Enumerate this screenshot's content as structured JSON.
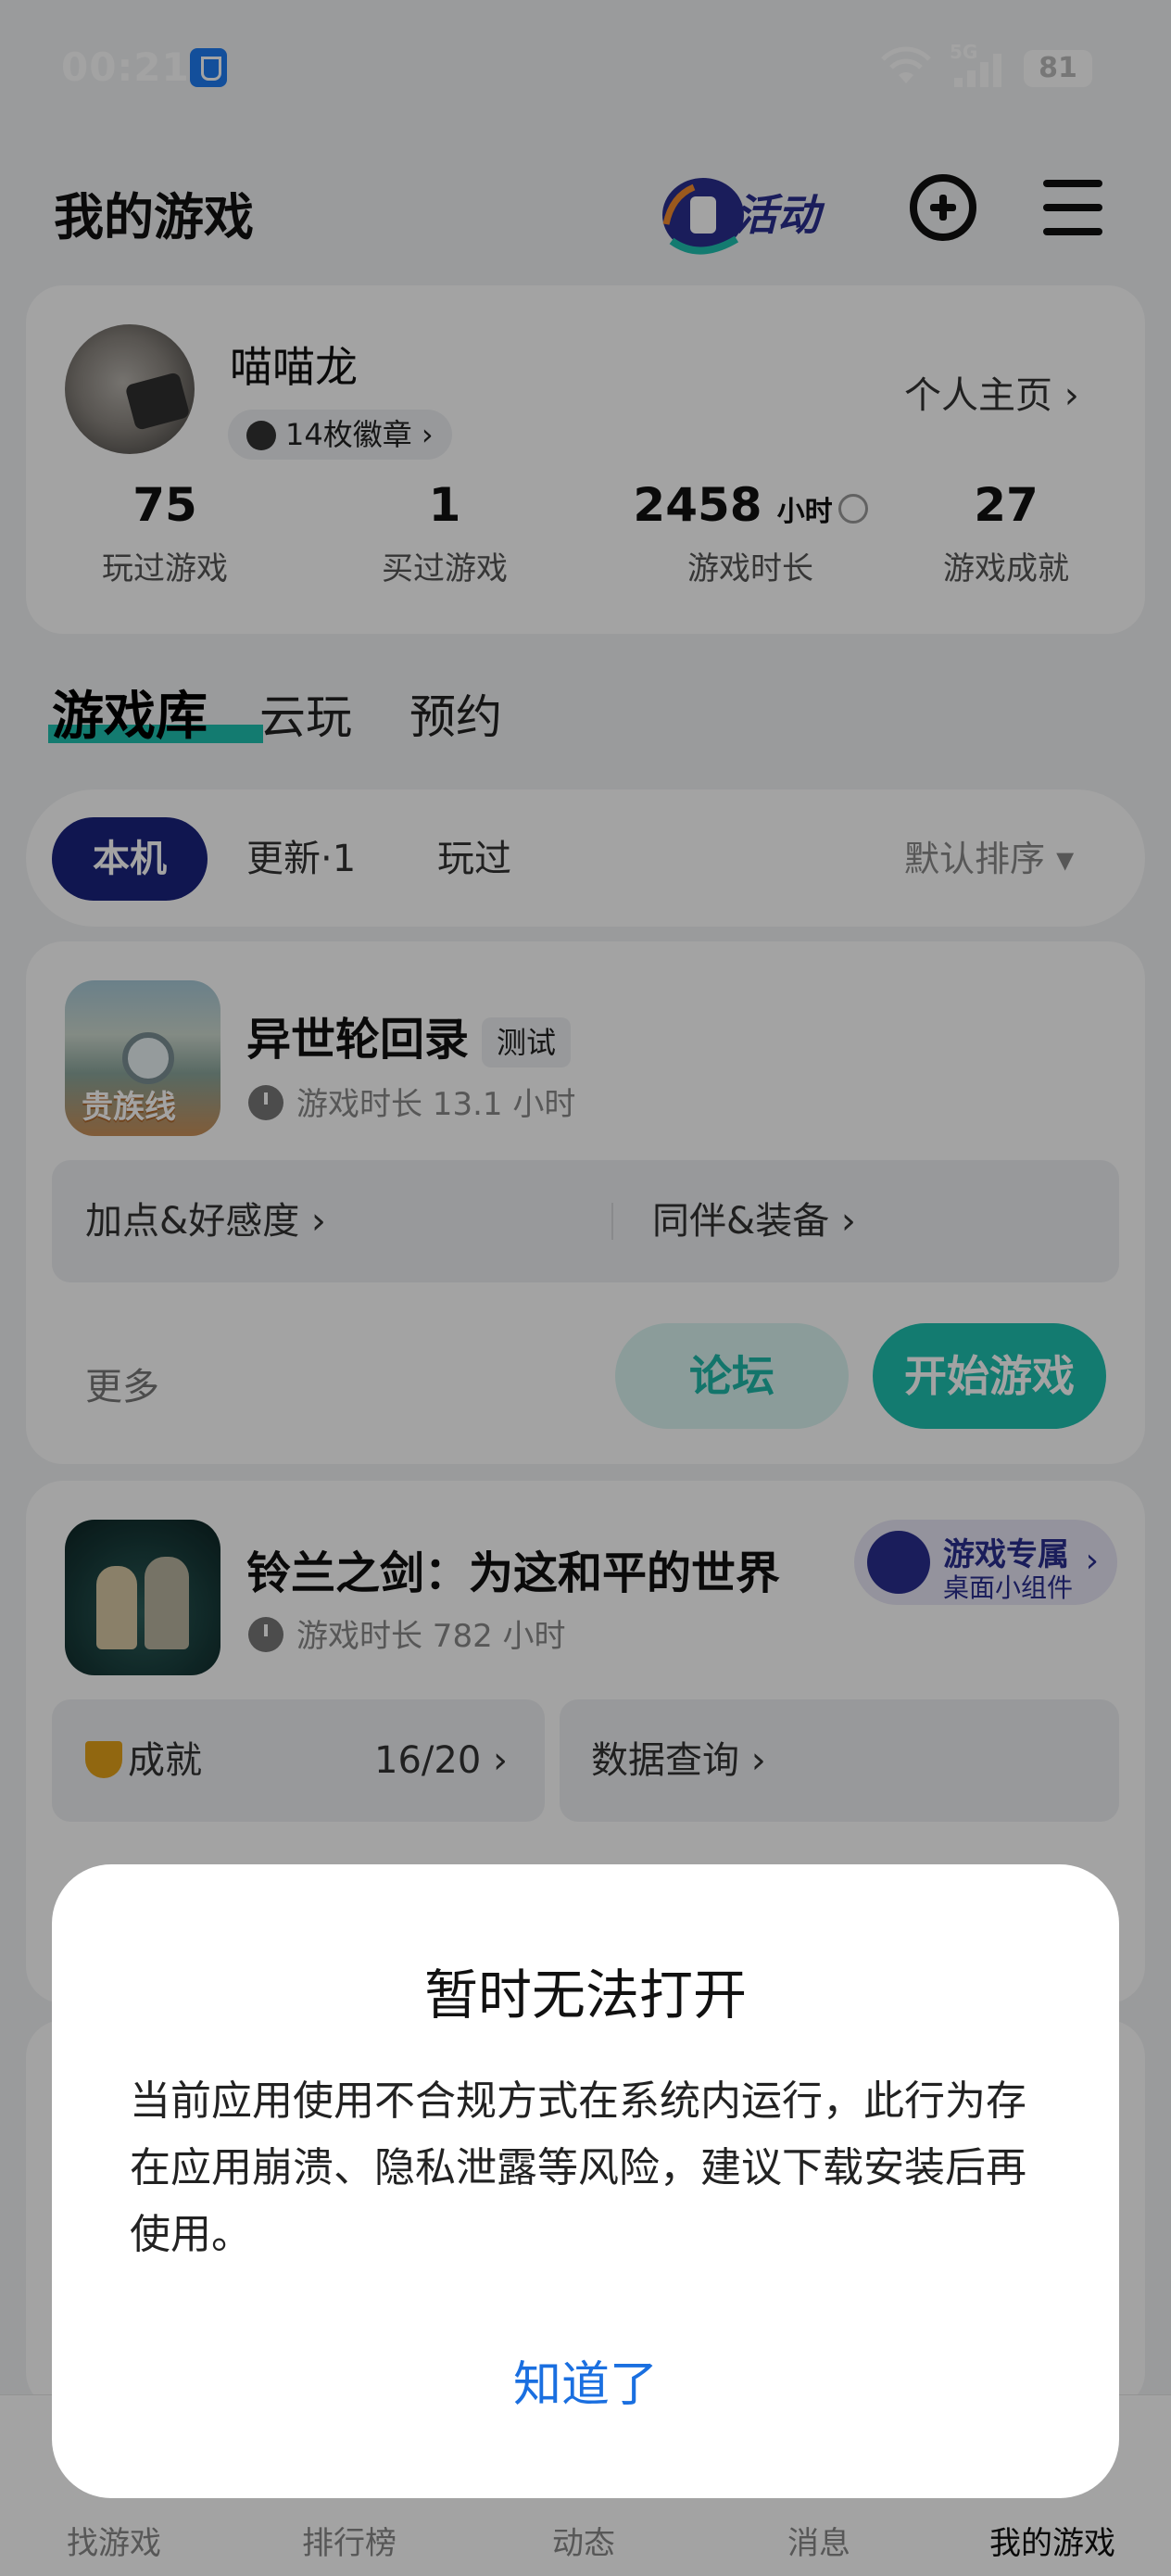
{
  "status_bar": {
    "time": "00:21",
    "network": "5G",
    "battery": "81"
  },
  "header": {
    "title": "我的游戏",
    "activity_label": "活动"
  },
  "profile": {
    "username": "喵喵龙",
    "badges": "14枚徽章 ›",
    "home_link": "个人主页 ›",
    "stats": [
      {
        "value": "75",
        "unit": "",
        "label": "玩过游戏"
      },
      {
        "value": "1",
        "unit": "",
        "label": "买过游戏"
      },
      {
        "value": "2458",
        "unit": "小时",
        "label": "游戏时长"
      },
      {
        "value": "27",
        "unit": "",
        "label": "游戏成就"
      }
    ]
  },
  "main_tabs": [
    "游戏库",
    "云玩",
    "预约"
  ],
  "filters": {
    "chips": [
      "本机",
      "更新·1",
      "玩过"
    ],
    "sort": "默认排序 ▾"
  },
  "games": [
    {
      "name": "异世轮回录",
      "tag": "测试",
      "icon_text": "贵族线",
      "playtime": "游戏时长 13.1 小时",
      "links": [
        "加点&好感度 ›",
        "同伴&装备 ›"
      ],
      "more": "更多",
      "forum": "论坛",
      "start": "开始游戏"
    },
    {
      "name": "铃兰之剑：为这和平的世界",
      "playtime": "游戏时长 782 小时",
      "widget_title": "游戏专属",
      "widget_sub": "桌面小组件",
      "achievement_label": "成就",
      "achievement_value": "16/20 ›",
      "data_query": "数据查询 ›"
    }
  ],
  "dialog": {
    "title": "暂时无法打开",
    "body": "当前应用使用不合规方式在系统内运行，此行为存在应用崩溃、隐私泄露等风险，建议下载安装后再使用。",
    "button": "知道了"
  },
  "bottom_nav": [
    "找游戏",
    "排行榜",
    "动态",
    "消息",
    "我的游戏"
  ],
  "colors": {
    "accent": "#1fc0b0",
    "chip_active": "#1a237e",
    "dialog_button": "#1a6fe0"
  }
}
